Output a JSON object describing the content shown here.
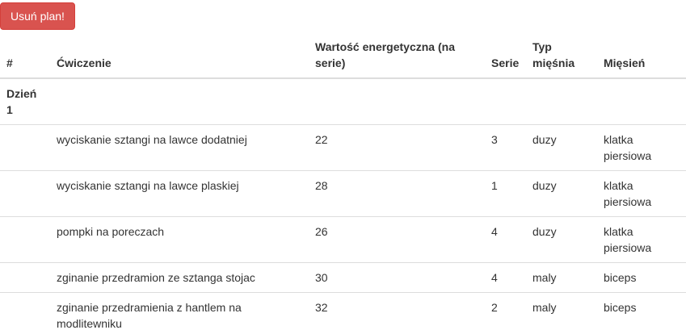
{
  "toolbar": {
    "delete_plan_label": "Usuń plan!"
  },
  "table": {
    "headers": {
      "index": "#",
      "exercise": "Ćwiczenie",
      "energy": "Wartość energetyczna (na serie)",
      "sets": "Serie",
      "muscle_type": "Typ mięśnia",
      "muscle": "Mięsień"
    },
    "day": {
      "label": "Dzień 1"
    },
    "rows": [
      {
        "exercise": "wyciskanie sztangi na lawce dodatniej",
        "energy": "22",
        "sets": "3",
        "muscle_type": "duzy",
        "muscle": "klatka piersiowa"
      },
      {
        "exercise": "wyciskanie sztangi na lawce plaskiej",
        "energy": "28",
        "sets": "1",
        "muscle_type": "duzy",
        "muscle": "klatka piersiowa"
      },
      {
        "exercise": "pompki na poreczach",
        "energy": "26",
        "sets": "4",
        "muscle_type": "duzy",
        "muscle": "klatka piersiowa"
      },
      {
        "exercise": "zginanie przedramion ze sztanga stojac",
        "energy": "30",
        "sets": "4",
        "muscle_type": "maly",
        "muscle": "biceps"
      },
      {
        "exercise": "zginanie przedramienia z hantlem na modlitewniku",
        "energy": "32",
        "sets": "2",
        "muscle_type": "maly",
        "muscle": "biceps"
      }
    ]
  },
  "colors": {
    "danger": "#d9534f",
    "border": "#dddddd",
    "text": "#333333"
  }
}
